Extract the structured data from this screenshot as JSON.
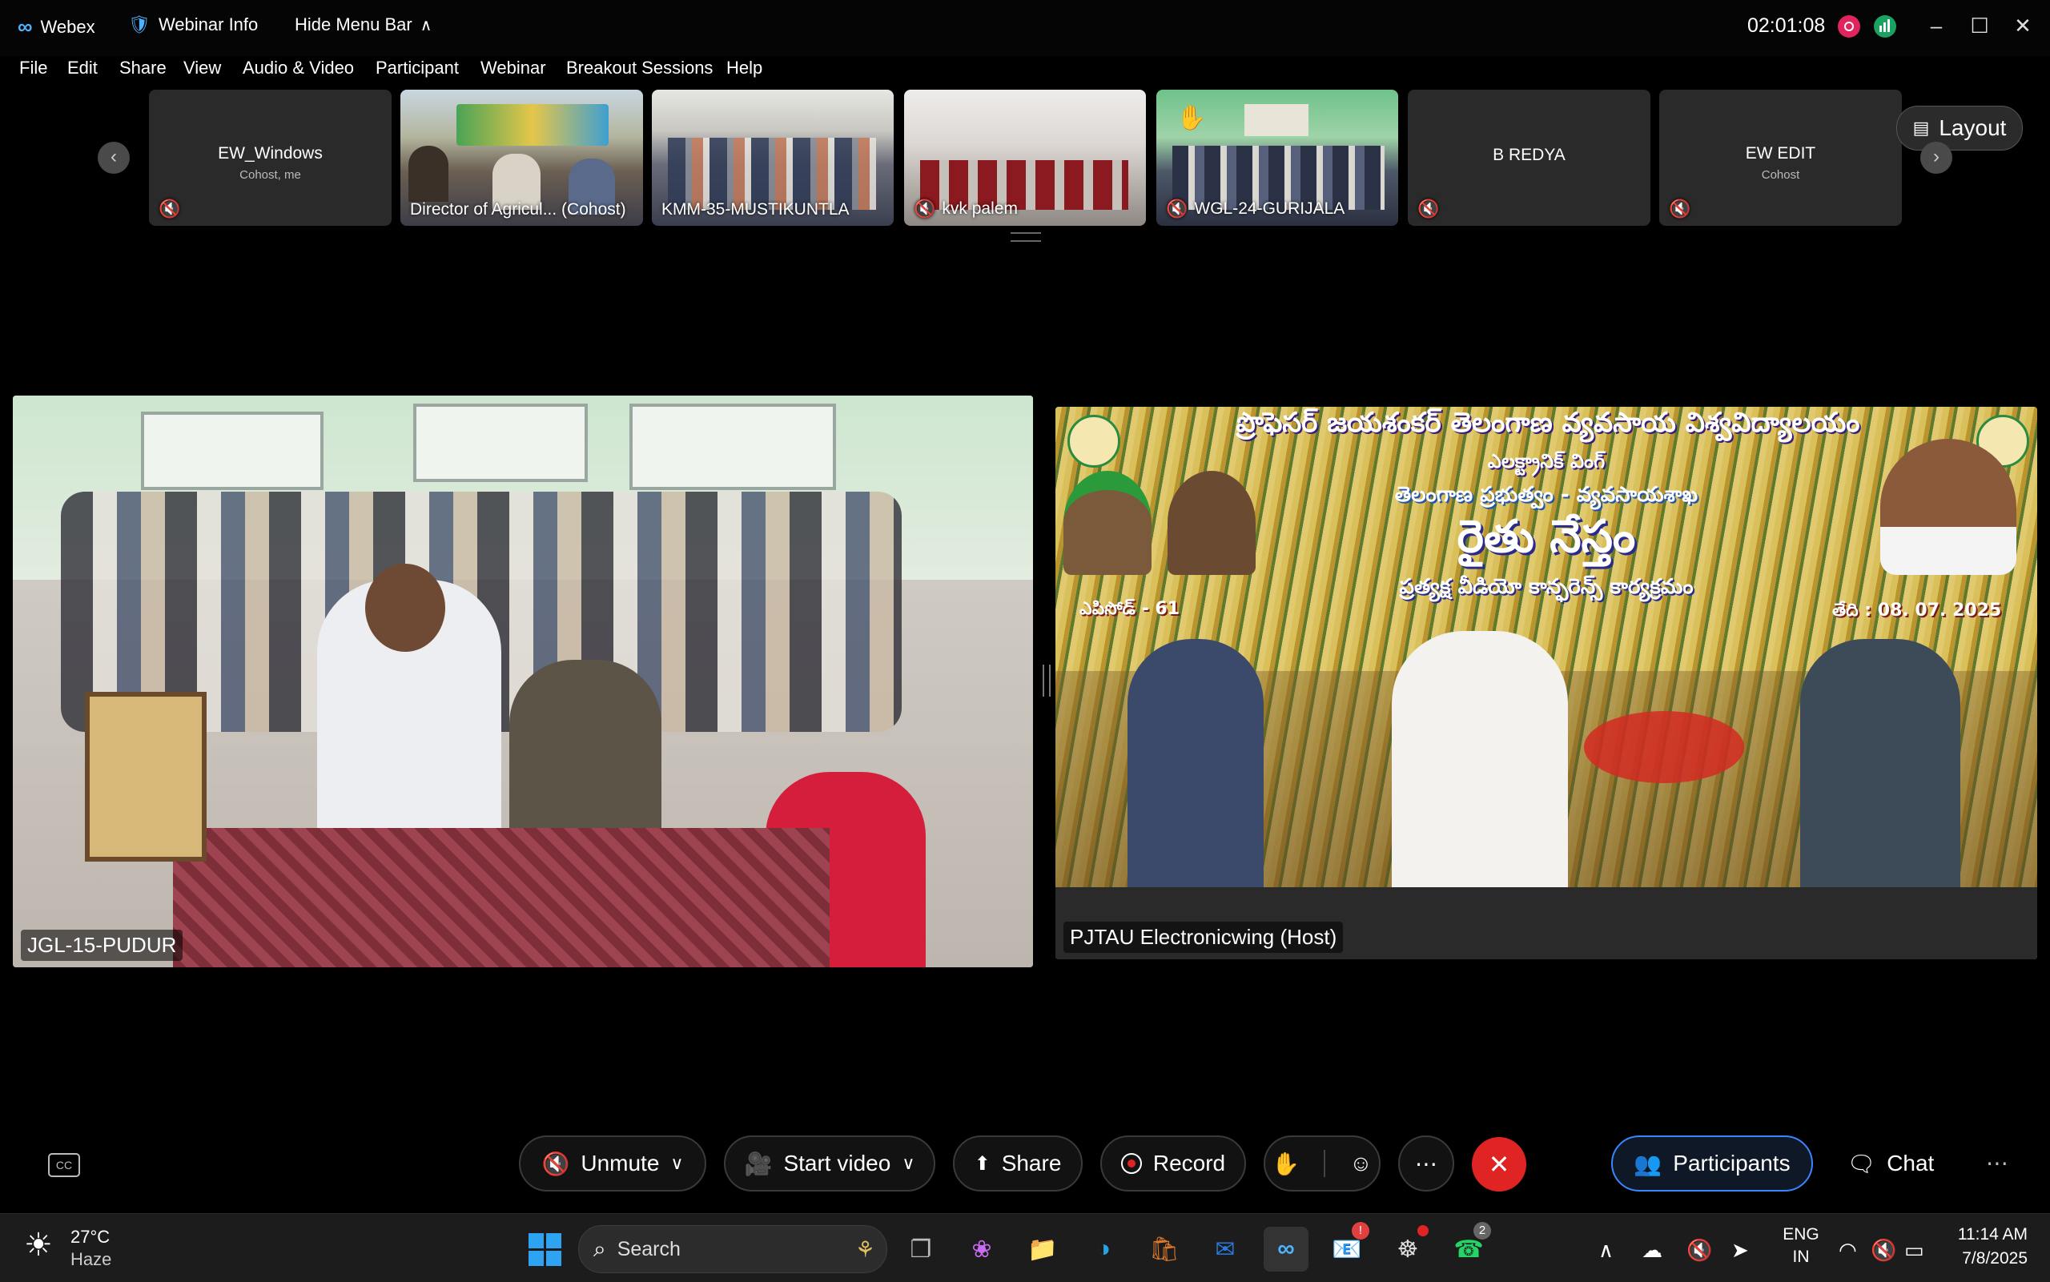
{
  "titlebar": {
    "app_name": "Webex",
    "webinar_info": "Webinar Info",
    "hide_menu_bar": "Hide Menu Bar",
    "timer": "02:01:08"
  },
  "menu": [
    "File",
    "Edit",
    "Share",
    "View",
    "Audio & Video",
    "Participant",
    "Webinar",
    "Breakout Sessions",
    "Help"
  ],
  "layout_button": "Layout",
  "participants_strip": [
    {
      "name": "EW_Windows",
      "role": "Cohost, me",
      "video": false,
      "muted": true
    },
    {
      "name": "Director of Agricul... (Cohost)",
      "video": true,
      "muted": false
    },
    {
      "name": "KMM-35-MUSTIKUNTLA",
      "video": true,
      "muted": false
    },
    {
      "name": "kvk palem",
      "video": true,
      "muted": true
    },
    {
      "name": "WGL-24-GURIJALA",
      "video": true,
      "muted": true
    },
    {
      "name": "B REDYA",
      "video": false,
      "muted": true
    },
    {
      "name": "EW EDIT",
      "role": "Cohost",
      "video": false,
      "muted": true
    }
  ],
  "main_videos": [
    {
      "label": "JGL-15-PUDUR"
    },
    {
      "label": "PJTAU Electronicwing (Host)",
      "banner_title": "ప్రొఫెసర్ జయశంకర్ తెలంగాణ వ్యవసాయ విశ్వవిద్యాలయం",
      "banner_sub1": "ఎలక్ట్రానిక్ వింగ్",
      "banner_sub2": "తెలంగాణ ప్రభుత్వం - వ్యవసాయశాఖ",
      "banner_main": "రైతు నేస్తం",
      "banner_sub3": "ప్రత్యక్ష వీడియో కాన్ఫరెన్స్ కార్యక్రమం",
      "episode": "ఎపిసోడ్ - 61",
      "date": "తేది : 08. 07. 2025"
    }
  ],
  "controls": {
    "unmute": "Unmute",
    "start_video": "Start video",
    "share": "Share",
    "record": "Record",
    "participants": "Participants",
    "chat": "Chat"
  },
  "taskbar": {
    "weather_temp": "27°C",
    "weather_desc": "Haze",
    "search_placeholder": "Search",
    "lang_top": "ENG",
    "lang_bottom": "IN",
    "time": "11:14 AM",
    "date": "7/8/2025",
    "outlook_badge": "!",
    "whatsapp_badge": "2"
  },
  "colors": {
    "accent": "#3a86ff",
    "end_call": "#e02424",
    "record": "#e02424"
  }
}
